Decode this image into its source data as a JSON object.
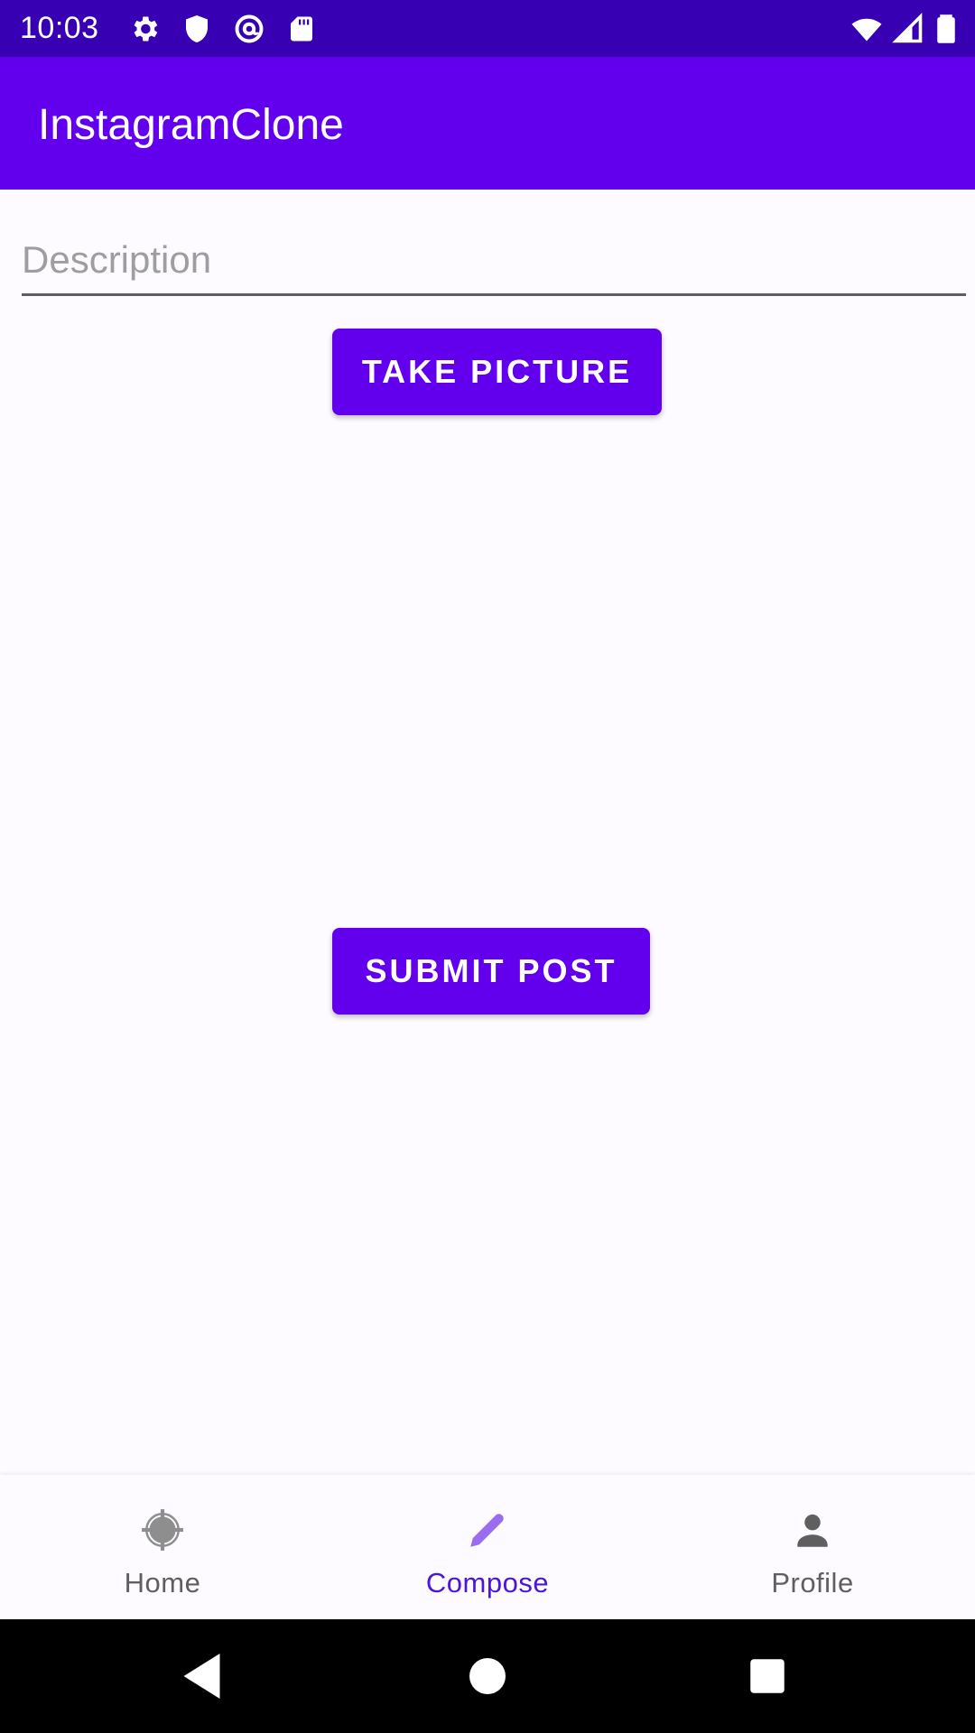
{
  "status_bar": {
    "time": "10:03",
    "left_icons": [
      "gear-icon",
      "shield-icon",
      "at-sign-icon",
      "sd-card-icon"
    ],
    "right_icons": [
      "wifi-icon",
      "cellular-signal-icon",
      "battery-icon"
    ]
  },
  "app_bar": {
    "title": "InstagramClone"
  },
  "compose": {
    "description_placeholder": "Description",
    "description_value": "",
    "take_picture_label": "Take Picture",
    "submit_post_label": "Submit Post"
  },
  "bottom_nav": {
    "items": [
      {
        "label": "Home",
        "icon": "home-target-icon",
        "active": false
      },
      {
        "label": "Compose",
        "icon": "pencil-icon",
        "active": true
      },
      {
        "label": "Profile",
        "icon": "person-icon",
        "active": false
      }
    ]
  },
  "system_nav": {
    "buttons": [
      "back-triangle-icon",
      "home-circle-icon",
      "recents-square-icon"
    ]
  },
  "colors": {
    "status_bar": "#3700B3",
    "primary": "#6200EE",
    "active_nav": "#4A16D9",
    "inactive_nav": "#5F5F5F",
    "background": "#FDFBFF"
  }
}
